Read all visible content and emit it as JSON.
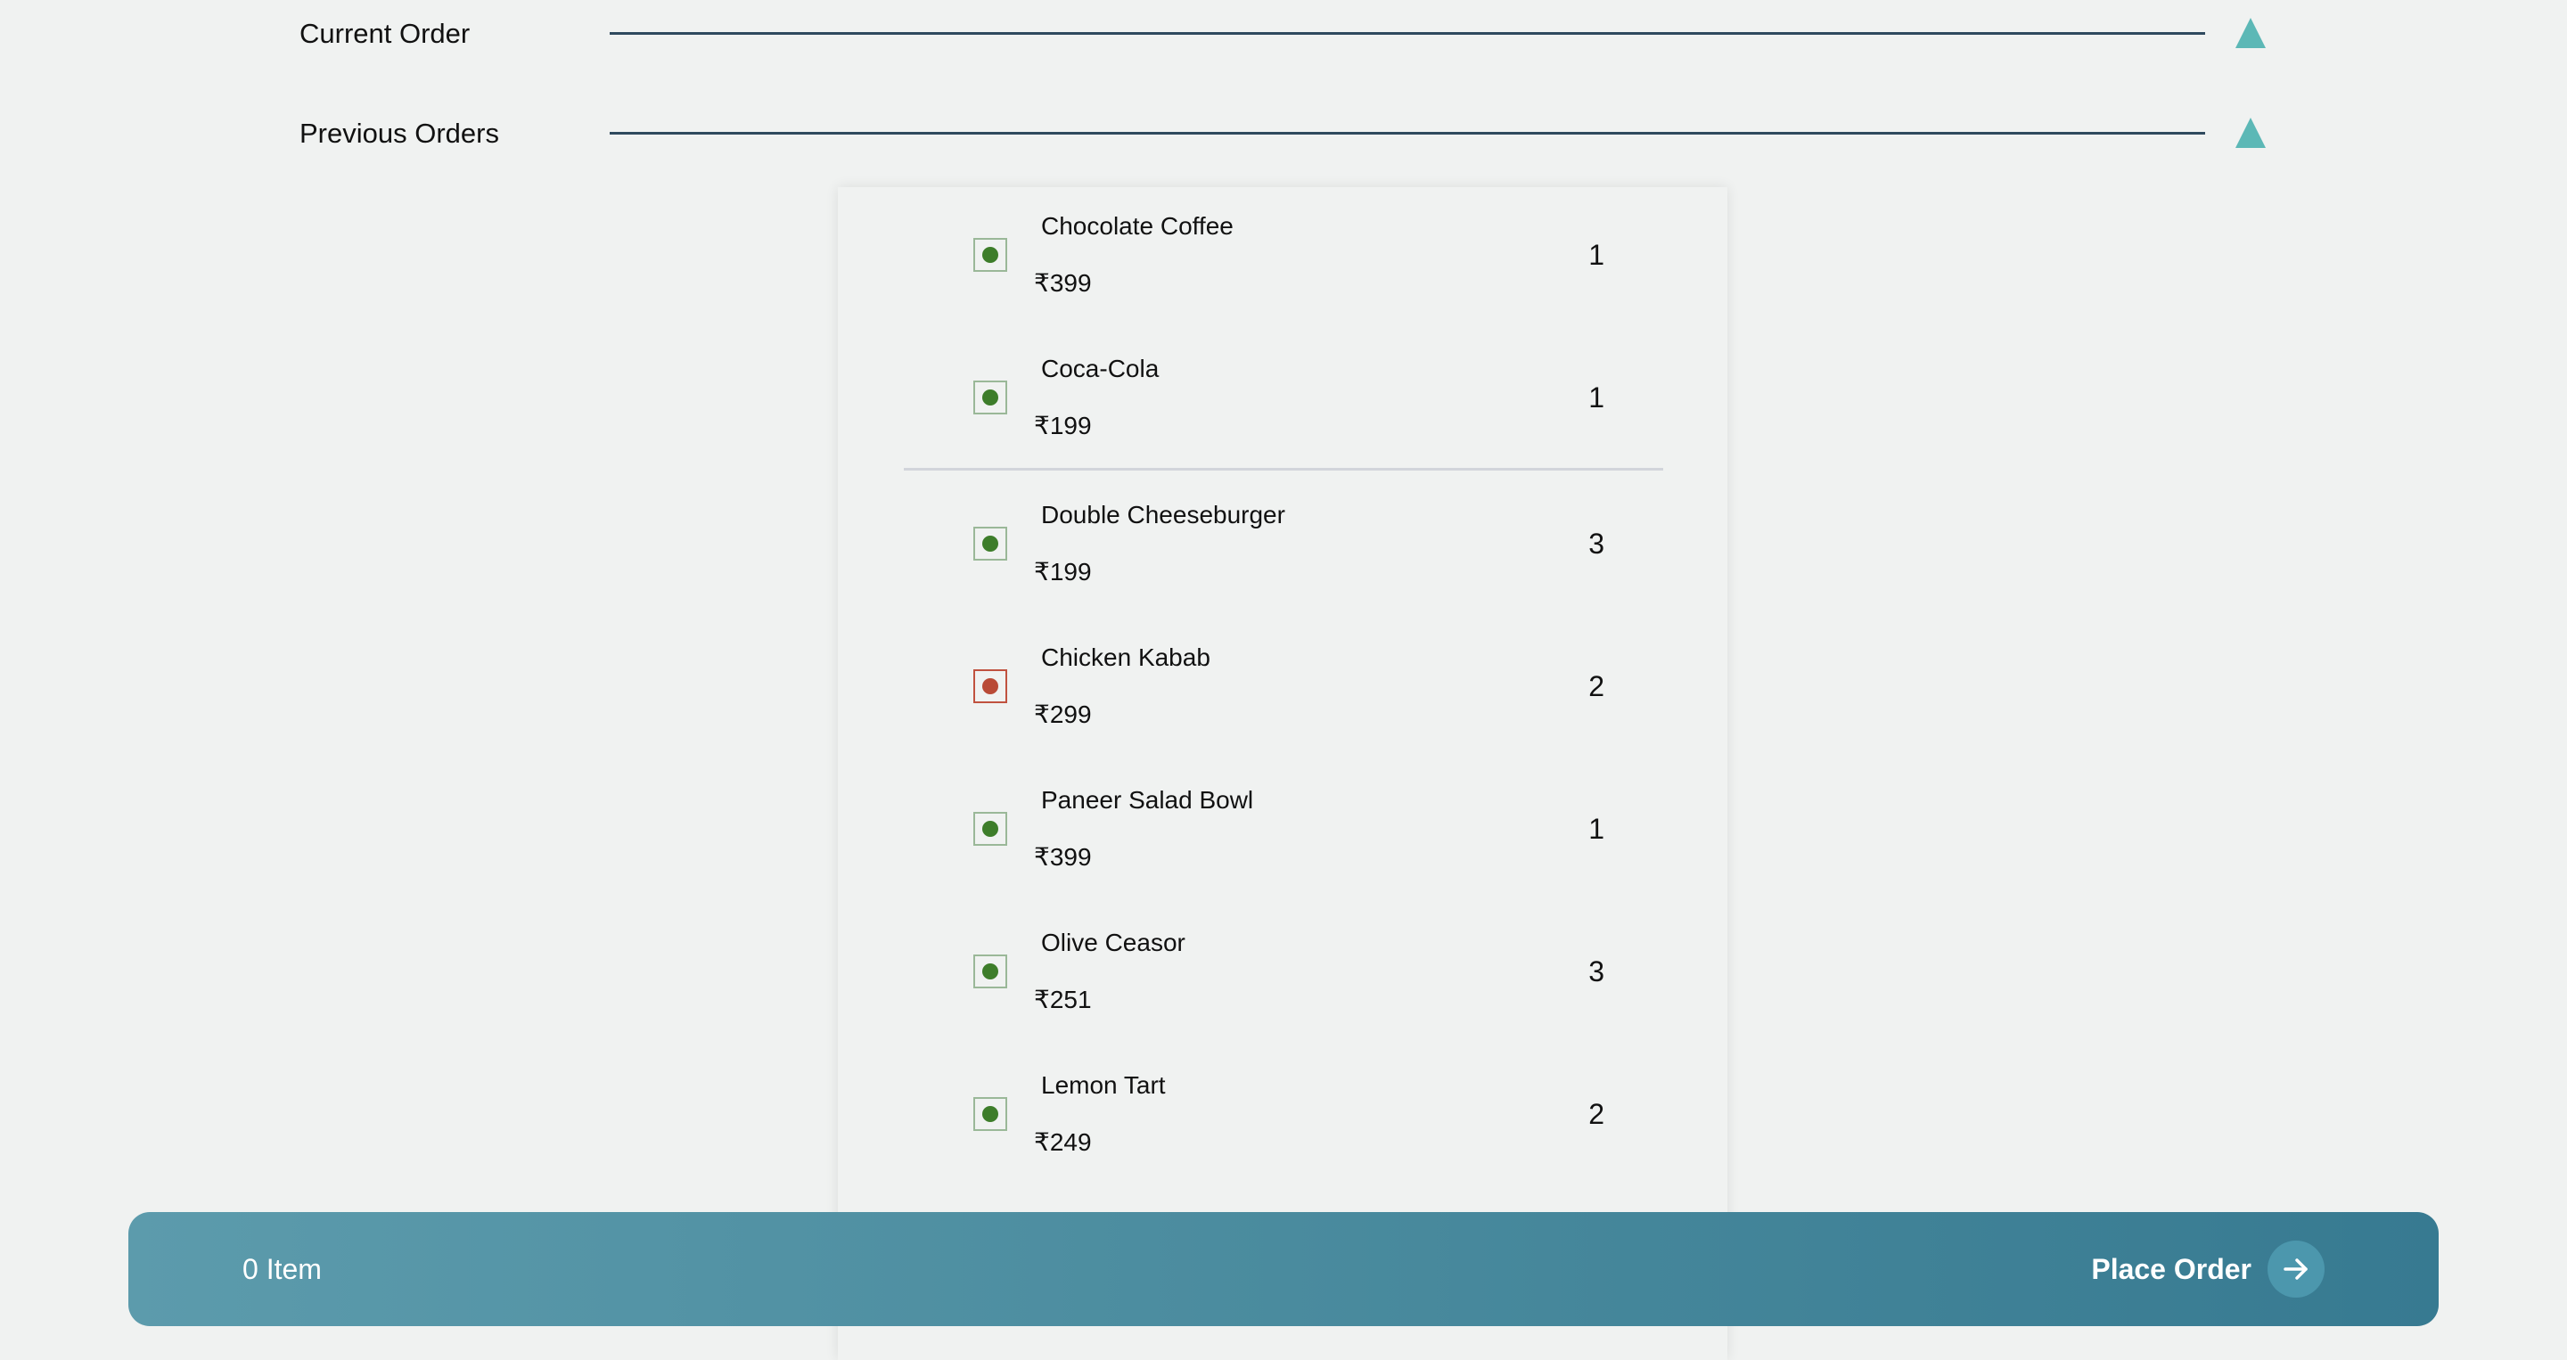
{
  "sections": [
    {
      "title": "Current Order",
      "toggle_icon": "triangle-up-icon"
    },
    {
      "title": "Previous Orders",
      "toggle_icon": "triangle-up-icon"
    }
  ],
  "colors": {
    "background": "#f0f2f1",
    "toggle_accent": "#5cb8b6",
    "veg_marker": "#3d7d2a",
    "nonveg_marker": "#b94a36",
    "bar_gradient_start": "#5c9bac",
    "bar_gradient_end": "#377a91"
  },
  "order_items": [
    {
      "name": "Chocolate Coffee",
      "price": "₹399",
      "quantity": "1",
      "type": "veg"
    },
    {
      "name": "Coca-Cola",
      "price": "₹199",
      "quantity": "1",
      "type": "veg"
    },
    {
      "name": "Double Cheeseburger",
      "price": "₹199",
      "quantity": "3",
      "type": "veg"
    },
    {
      "name": "Chicken Kabab",
      "price": "₹299",
      "quantity": "2",
      "type": "non-veg"
    },
    {
      "name": "Paneer Salad Bowl",
      "price": "₹399",
      "quantity": "1",
      "type": "veg"
    },
    {
      "name": "Olive Ceasor",
      "price": "₹251",
      "quantity": "3",
      "type": "veg"
    },
    {
      "name": "Lemon Tart",
      "price": "₹249",
      "quantity": "2",
      "type": "veg"
    }
  ],
  "bottom_bar": {
    "items_count": "0 Item",
    "place_order_label": "Place Order",
    "place_order_icon": "arrow-right-icon"
  }
}
